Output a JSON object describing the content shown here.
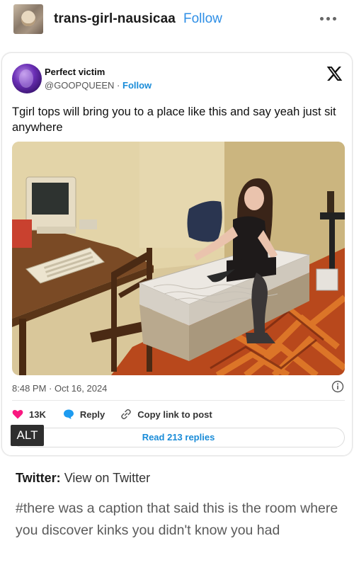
{
  "post": {
    "blog_name": "trans-girl-nausicaa",
    "follow_label": "Follow",
    "more_icon": "more-horizontal-icon"
  },
  "tweet": {
    "display_name": "Perfect victim",
    "handle": "@GOOPQUEEN",
    "separator": " · ",
    "follow_label": "Follow",
    "brand_icon": "x-logo-icon",
    "text": "Tgirl tops will bring you to a place like this and say yeah just sit anywhere",
    "photo_alt_badge": "ALT",
    "timestamp": "8:48 PM · Oct 16, 2024",
    "info_icon": "info-icon",
    "likes": "13K",
    "reply_label": "Reply",
    "copy_link_label": "Copy link to post",
    "read_replies_label": "Read 213 replies",
    "colors": {
      "accent_blue": "#1a8cd8",
      "heart_pink": "#f91880",
      "reply_blue": "#1d9bf0"
    }
  },
  "source": {
    "label": "Twitter:",
    "link_text": "View on Twitter"
  },
  "tags": {
    "text": "#there was a caption that said this is the room where you discover kinks you didn't know you had"
  }
}
